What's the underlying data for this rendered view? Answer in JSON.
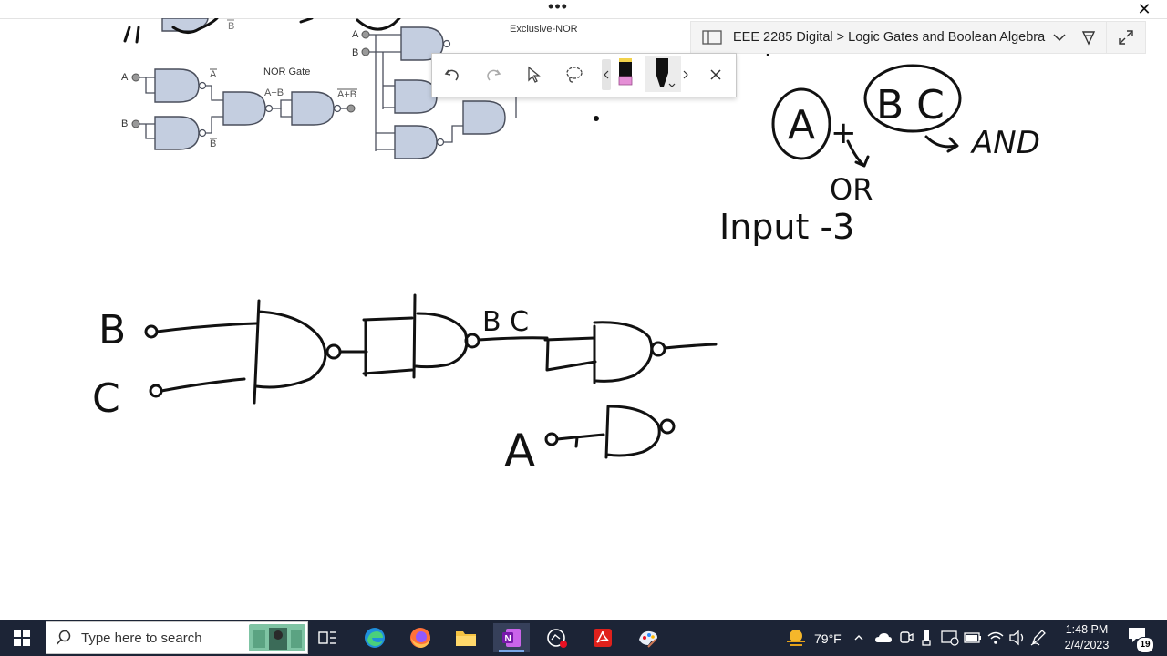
{
  "top_bar": {
    "menu_dots": "•••",
    "close_glyph": "✕"
  },
  "breadcrumb": {
    "text": "EEE 2285 Digital > Logic Gates and Boolean Algebra"
  },
  "diagram_labels": {
    "nor_gate": "NOR Gate",
    "exclusive_nor": "Exclusive-NOR",
    "in_a": "A",
    "in_b": "B",
    "a_bar": "A",
    "b_bar": "B",
    "a_plus_b": "A+B",
    "a_plus_b_bar": "A+B",
    "xnor_a": "A",
    "xnor_b": "B"
  },
  "handwriting": {
    "expr_a": "A",
    "expr_plus": "+",
    "expr_bc": "B C",
    "and_label": "AND",
    "or_label": "OR",
    "input_label": "Input -3",
    "b_input": "B",
    "c_input": "C",
    "bc_label": "B C",
    "a_input": "A"
  },
  "taskbar": {
    "search_placeholder": "Type here to search",
    "weather": "79°F",
    "time": "1:48 PM",
    "date": "2/4/2023",
    "notifications": "19"
  },
  "colors": {
    "taskbar_bg": "#1c2436",
    "gate_fill": "#c4cee0",
    "gate_stroke": "#4a4f5c",
    "pen_pink": "#e58fd6"
  }
}
